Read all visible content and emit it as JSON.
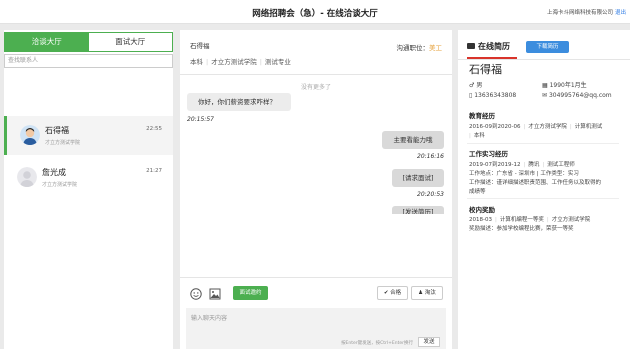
{
  "topbar": {
    "title": "网络招聘会（急）- 在线洽谈大厅",
    "company": "上海卡斗网络科技有限公司",
    "logout": "退出"
  },
  "sidebar": {
    "tabs": [
      {
        "label": "洽谈大厅",
        "active": true
      },
      {
        "label": "面试大厅",
        "active": false
      }
    ],
    "search_placeholder": "查找联系人",
    "contacts": [
      {
        "name": "石得福",
        "org": "才立方测试学院",
        "time": "22:55",
        "selected": true
      },
      {
        "name": "詹光成",
        "org": "才立方测试学院",
        "time": "21:27",
        "selected": false
      }
    ]
  },
  "chat": {
    "header": {
      "name": "石得福",
      "position_label": "沟通职位：",
      "position_value": "美工",
      "tags": [
        "本科",
        "才立方测试学院",
        "测试专业"
      ]
    },
    "no_more": "没有更多了",
    "messages": {
      "m1": {
        "text": "你好，你们薪资要求咋样？",
        "time": "20:15:57"
      },
      "m2": {
        "text": "主要看能力哦",
        "time": "20:16:16"
      },
      "m3": {
        "text": "[请求面试]",
        "time": "20:20:53"
      },
      "m4": {
        "text": "[发送简历]"
      }
    },
    "toolbar": {
      "interview_btn": "面试邀约",
      "pass_btn": "合格",
      "reject_btn": "淘汰"
    },
    "input": {
      "placeholder": "输入聊天内容",
      "hint": "按Enter键发送，按Ctrl+Enter换行",
      "send": "发送"
    }
  },
  "resume": {
    "title": "在线简历",
    "download_btn": "下载简历",
    "name": "石得福",
    "gender": "男",
    "birth": "1990年1月生",
    "phone": "13636343808",
    "email": "304995764@qq.com",
    "education": {
      "title": "教育经历",
      "line1": [
        "2016-09到2020-06",
        "才立方测试学院",
        "计算机测试"
      ],
      "line2": "本科"
    },
    "internship": {
      "title": "工作实习经历",
      "line1": [
        "2019-07到2019-12",
        "腾讯",
        "测试工程师"
      ],
      "line2": "工作地点：广东省 - 深圳市 | 工作类型：实习",
      "line3": "工作描述：谨详细描述职责范围、工作任务以及取得的",
      "line4": "成绩等"
    },
    "awards": {
      "title": "校内奖励",
      "line1": [
        "2018-03",
        "计算机编程一等奖",
        "才立方测试学院"
      ],
      "line2": "奖励描述：参加学校编程比赛，荣获一等奖"
    }
  },
  "colors": {
    "accent_green": "#4caf50",
    "accent_blue": "#3c8dde",
    "accent_red": "#d9342b",
    "position_orange": "#e6a23c"
  }
}
